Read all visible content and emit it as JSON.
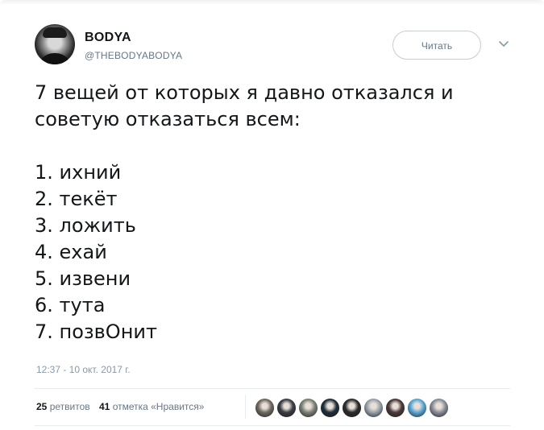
{
  "tweet": {
    "author_name": "BODYA",
    "author_handle": "@THEBODYABODYA",
    "follow_label": "Читать",
    "text": "7 вещей от которых я давно отказался и\nсоветую отказаться всем:\n\n1. ихний\n2. текёт\n3. ложить\n4. ехай\n5. извени\n6. тута\n7. позвОнит",
    "timestamp": "12:37 - 10 окт. 2017 г."
  },
  "stats": {
    "retweets_count": "25",
    "retweets_label": "ретвитов",
    "likes_count": "41",
    "likes_label": "отметка «Нравится»"
  },
  "icons": {
    "avatar": "avatar",
    "menu": "chevron-down-icon"
  },
  "likers": {
    "count": 9,
    "colors": [
      "#6f6a61",
      "#3a3d44",
      "#7a8276",
      "#1f2e3a",
      "#2c2c2c",
      "#9aa2ab",
      "#4b3a3a",
      "#5aa9d6",
      "#8a8f99"
    ]
  },
  "colors": {
    "text": "#14171a",
    "muted": "#657786",
    "timestamp": "#8899a6",
    "divider": "#e6ecf0"
  }
}
